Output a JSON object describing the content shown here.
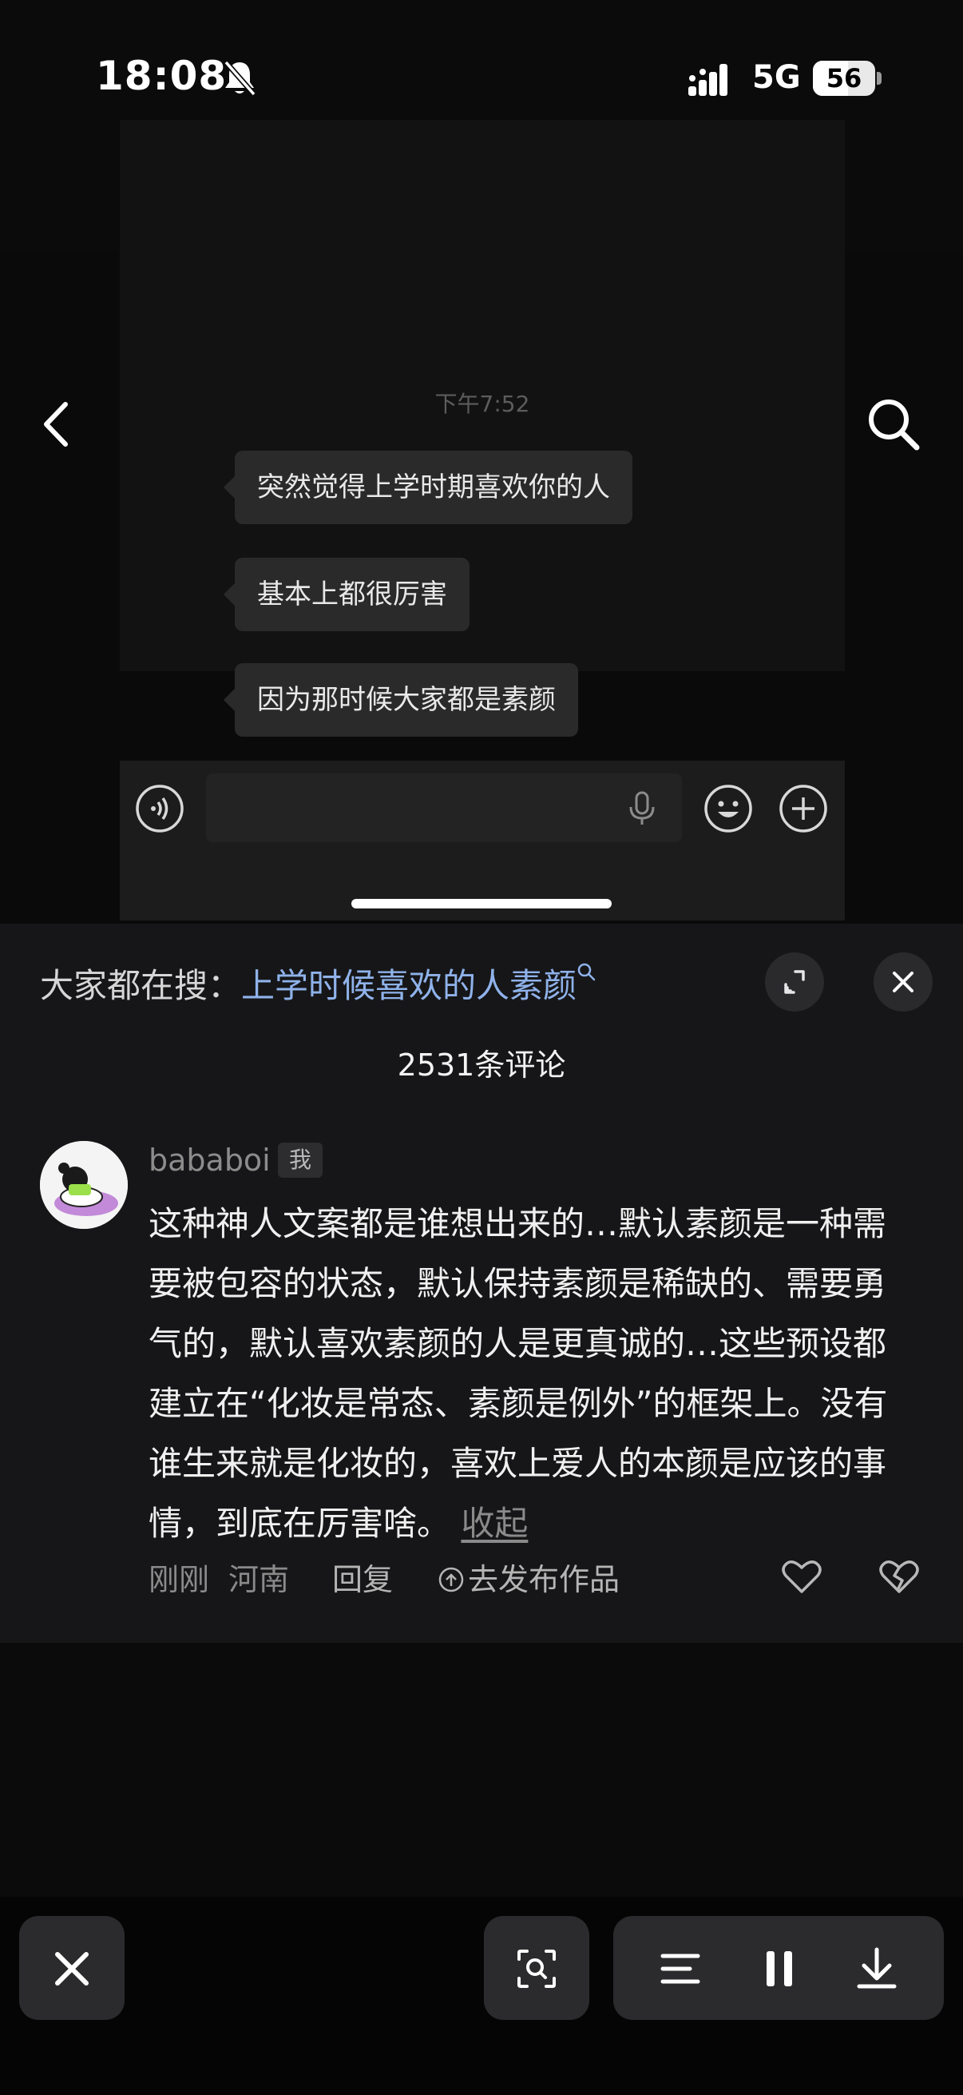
{
  "status_bar": {
    "time": "18:08",
    "network": "5G",
    "battery": "56",
    "battery_level": 0.56
  },
  "chat": {
    "timestamp": "下午7:52",
    "messages": [
      "突然觉得上学时期喜欢你的人",
      "基本上都很厉害",
      "因为那时候大家都是素颜"
    ]
  },
  "hot_search": {
    "label": "大家都在搜：",
    "query": "上学时候喜欢的人素颜"
  },
  "comments": {
    "count_label": "2531条评论",
    "items": [
      {
        "username": "bababoi",
        "badge": "我",
        "text": "这种神人文案都是谁想出来的…默认素颜是一种需要被包容的状态，默认保持素颜是稀缺的、需要勇气的，默认喜欢素颜的人是更真诚的…这些预设都建立在“化妆是常态、素颜是例外”的框架上。没有谁生来就是化妆的，喜欢上爱人的本颜是应该的事情，到底在厉害啥。",
        "collapse_label": "收起",
        "time": "刚刚",
        "location": "河南",
        "reply_label": "回复",
        "publish_label": "去发布作品"
      }
    ]
  },
  "icons": {
    "status": [
      "bell-slash-icon",
      "signal-icon"
    ],
    "video": [
      "back-icon",
      "search-icon",
      "voice-icon",
      "mic-icon",
      "emoji-icon",
      "plus-icon"
    ],
    "panel": [
      "expand-icon",
      "close-icon",
      "like-icon",
      "dislike-icon"
    ],
    "toolbar": [
      "close-icon",
      "scan-icon",
      "text-list-icon",
      "pause-icon",
      "download-icon"
    ]
  },
  "colors": {
    "accent_link": "#8fb2ea",
    "panel_bg": "#161618",
    "background": "#0b0b0c"
  }
}
